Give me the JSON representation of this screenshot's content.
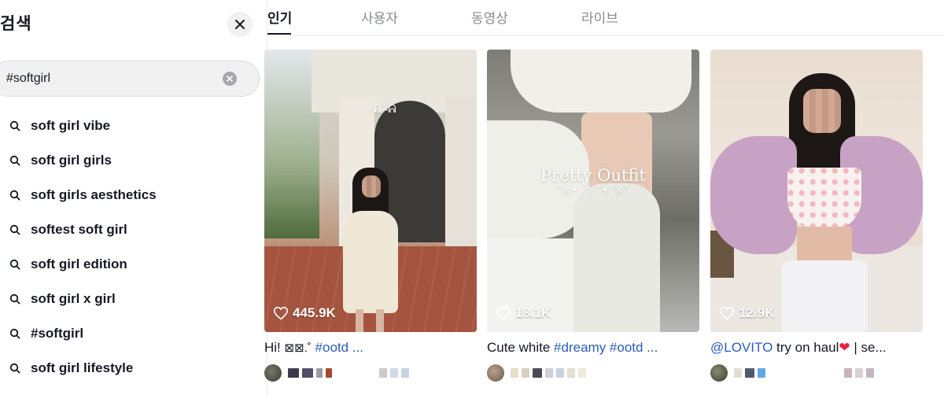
{
  "search_panel": {
    "title": "검색",
    "query": "#softgirl",
    "suggestions": [
      "soft girl vibe",
      "soft girl girls",
      "soft girls aesthetics",
      "softest soft girl",
      "soft girl edition",
      "soft girl x girl",
      "#softgirl",
      "soft girl lifestyle"
    ]
  },
  "tabs": [
    {
      "label": "인기",
      "active": true
    },
    {
      "label": "사용자",
      "active": false
    },
    {
      "label": "동영상",
      "active": false
    },
    {
      "label": "라이브",
      "active": false
    }
  ],
  "videos": [
    {
      "likes": "445.9K",
      "caption_text": "Hi! ",
      "caption_glyph": "⊠⊠.˚",
      "caption_tag": "#ootd ...",
      "caption_rest": "",
      "sticker": "ᕱ⑅ᕱ"
    },
    {
      "likes": "18.1K",
      "caption_text": "Cute white ",
      "caption_tag": "#dreamy #ootd ...",
      "overlay_title": "Pretty Outfit",
      "overlay_deco": "˚※•.◌.˚•˚※˚"
    },
    {
      "likes": "12.9K",
      "caption_tag": "@LOVITO",
      "caption_text": " try on haul",
      "caption_heart": "❤",
      "caption_rest": " | se..."
    }
  ],
  "colors": {
    "link": "#2b5db9",
    "text": "#161823",
    "muted": "#8a8b91",
    "heart": "#e8203f"
  }
}
